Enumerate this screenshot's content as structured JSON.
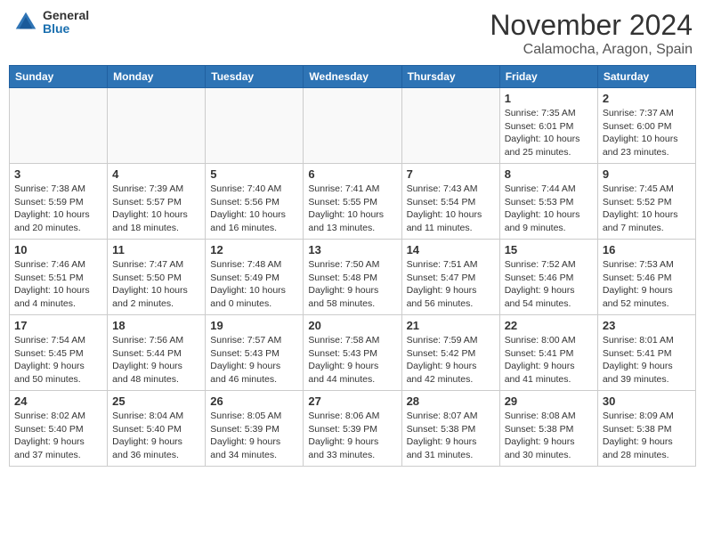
{
  "header": {
    "logo_general": "General",
    "logo_blue": "Blue",
    "month": "November 2024",
    "location": "Calamocha, Aragon, Spain"
  },
  "weekdays": [
    "Sunday",
    "Monday",
    "Tuesday",
    "Wednesday",
    "Thursday",
    "Friday",
    "Saturday"
  ],
  "weeks": [
    {
      "days": [
        {
          "num": "",
          "info": ""
        },
        {
          "num": "",
          "info": ""
        },
        {
          "num": "",
          "info": ""
        },
        {
          "num": "",
          "info": ""
        },
        {
          "num": "",
          "info": ""
        },
        {
          "num": "1",
          "info": "Sunrise: 7:35 AM\nSunset: 6:01 PM\nDaylight: 10 hours\nand 25 minutes."
        },
        {
          "num": "2",
          "info": "Sunrise: 7:37 AM\nSunset: 6:00 PM\nDaylight: 10 hours\nand 23 minutes."
        }
      ]
    },
    {
      "days": [
        {
          "num": "3",
          "info": "Sunrise: 7:38 AM\nSunset: 5:59 PM\nDaylight: 10 hours\nand 20 minutes."
        },
        {
          "num": "4",
          "info": "Sunrise: 7:39 AM\nSunset: 5:57 PM\nDaylight: 10 hours\nand 18 minutes."
        },
        {
          "num": "5",
          "info": "Sunrise: 7:40 AM\nSunset: 5:56 PM\nDaylight: 10 hours\nand 16 minutes."
        },
        {
          "num": "6",
          "info": "Sunrise: 7:41 AM\nSunset: 5:55 PM\nDaylight: 10 hours\nand 13 minutes."
        },
        {
          "num": "7",
          "info": "Sunrise: 7:43 AM\nSunset: 5:54 PM\nDaylight: 10 hours\nand 11 minutes."
        },
        {
          "num": "8",
          "info": "Sunrise: 7:44 AM\nSunset: 5:53 PM\nDaylight: 10 hours\nand 9 minutes."
        },
        {
          "num": "9",
          "info": "Sunrise: 7:45 AM\nSunset: 5:52 PM\nDaylight: 10 hours\nand 7 minutes."
        }
      ]
    },
    {
      "days": [
        {
          "num": "10",
          "info": "Sunrise: 7:46 AM\nSunset: 5:51 PM\nDaylight: 10 hours\nand 4 minutes."
        },
        {
          "num": "11",
          "info": "Sunrise: 7:47 AM\nSunset: 5:50 PM\nDaylight: 10 hours\nand 2 minutes."
        },
        {
          "num": "12",
          "info": "Sunrise: 7:48 AM\nSunset: 5:49 PM\nDaylight: 10 hours\nand 0 minutes."
        },
        {
          "num": "13",
          "info": "Sunrise: 7:50 AM\nSunset: 5:48 PM\nDaylight: 9 hours\nand 58 minutes."
        },
        {
          "num": "14",
          "info": "Sunrise: 7:51 AM\nSunset: 5:47 PM\nDaylight: 9 hours\nand 56 minutes."
        },
        {
          "num": "15",
          "info": "Sunrise: 7:52 AM\nSunset: 5:46 PM\nDaylight: 9 hours\nand 54 minutes."
        },
        {
          "num": "16",
          "info": "Sunrise: 7:53 AM\nSunset: 5:46 PM\nDaylight: 9 hours\nand 52 minutes."
        }
      ]
    },
    {
      "days": [
        {
          "num": "17",
          "info": "Sunrise: 7:54 AM\nSunset: 5:45 PM\nDaylight: 9 hours\nand 50 minutes."
        },
        {
          "num": "18",
          "info": "Sunrise: 7:56 AM\nSunset: 5:44 PM\nDaylight: 9 hours\nand 48 minutes."
        },
        {
          "num": "19",
          "info": "Sunrise: 7:57 AM\nSunset: 5:43 PM\nDaylight: 9 hours\nand 46 minutes."
        },
        {
          "num": "20",
          "info": "Sunrise: 7:58 AM\nSunset: 5:43 PM\nDaylight: 9 hours\nand 44 minutes."
        },
        {
          "num": "21",
          "info": "Sunrise: 7:59 AM\nSunset: 5:42 PM\nDaylight: 9 hours\nand 42 minutes."
        },
        {
          "num": "22",
          "info": "Sunrise: 8:00 AM\nSunset: 5:41 PM\nDaylight: 9 hours\nand 41 minutes."
        },
        {
          "num": "23",
          "info": "Sunrise: 8:01 AM\nSunset: 5:41 PM\nDaylight: 9 hours\nand 39 minutes."
        }
      ]
    },
    {
      "days": [
        {
          "num": "24",
          "info": "Sunrise: 8:02 AM\nSunset: 5:40 PM\nDaylight: 9 hours\nand 37 minutes."
        },
        {
          "num": "25",
          "info": "Sunrise: 8:04 AM\nSunset: 5:40 PM\nDaylight: 9 hours\nand 36 minutes."
        },
        {
          "num": "26",
          "info": "Sunrise: 8:05 AM\nSunset: 5:39 PM\nDaylight: 9 hours\nand 34 minutes."
        },
        {
          "num": "27",
          "info": "Sunrise: 8:06 AM\nSunset: 5:39 PM\nDaylight: 9 hours\nand 33 minutes."
        },
        {
          "num": "28",
          "info": "Sunrise: 8:07 AM\nSunset: 5:38 PM\nDaylight: 9 hours\nand 31 minutes."
        },
        {
          "num": "29",
          "info": "Sunrise: 8:08 AM\nSunset: 5:38 PM\nDaylight: 9 hours\nand 30 minutes."
        },
        {
          "num": "30",
          "info": "Sunrise: 8:09 AM\nSunset: 5:38 PM\nDaylight: 9 hours\nand 28 minutes."
        }
      ]
    }
  ]
}
